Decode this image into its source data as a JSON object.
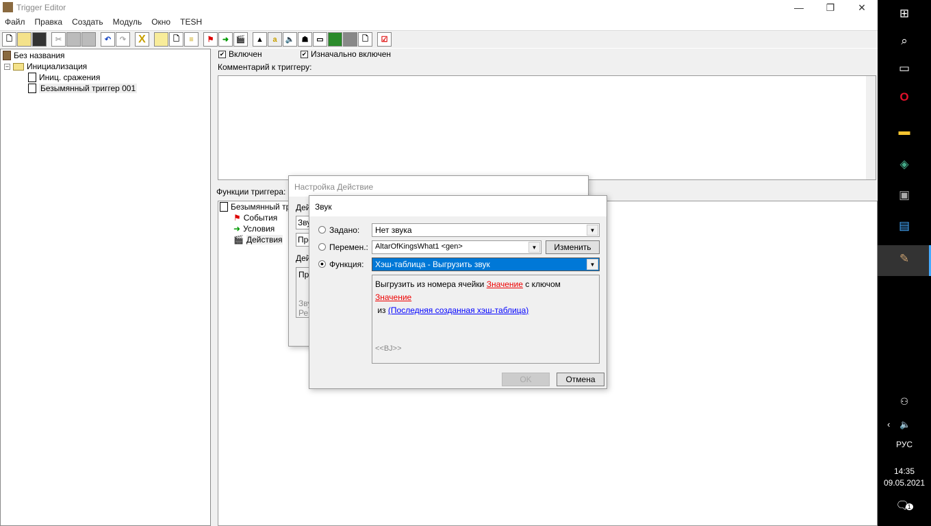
{
  "window": {
    "title": "Trigger Editor",
    "minimize": "—",
    "restore": "❐",
    "close": "✕"
  },
  "menu": [
    "Файл",
    "Правка",
    "Создать",
    "Модуль",
    "Окно",
    "TESH"
  ],
  "toolbar": [
    "new",
    "open",
    "save",
    "cut",
    "copy",
    "paste",
    "undo",
    "redo",
    "X",
    "folder",
    "trigger",
    "comment",
    "event",
    "condition",
    "action",
    "terrain",
    "a",
    "sound",
    "unit",
    "tileset",
    "jass",
    "object",
    "import",
    "test"
  ],
  "tree": {
    "root": "Без названия",
    "category": "Инициализация",
    "items": [
      "Иниц. сражения",
      "Безымянный триггер 001"
    ]
  },
  "trigger": {
    "enabled_label": "Включен",
    "initially_on_label": "Изначально включен",
    "comment_label": "Комментарий к триггеру:",
    "functions_label": "Функции триггера:",
    "func_root": "Безымянный тр",
    "events": "События",
    "conditions": "Условия",
    "actions": "Действия"
  },
  "back_dialog": {
    "title": "Настройка Действие",
    "frag1": "Дей",
    "frag2": "Зву",
    "frag3": "Про",
    "frag4": "Дей",
    "frag5": "Пр",
    "frag6": "Зву",
    "frag7": "Ре"
  },
  "dialog": {
    "title": "Звук",
    "preset_label": "Задано:",
    "preset_value": "Нет звука",
    "var_label": "Перемен.:",
    "var_value": "AltarOfKingsWhat1 <gen>",
    "edit_button": "Изменить",
    "func_label": "Функция:",
    "func_value": "Хэш-таблица - Выгрузить звук",
    "desc_1": "Выгрузить из номера ячейки",
    "param_1": "Значение",
    "desc_2": "с ключом",
    "param_2": "Значение",
    "desc_3": "из",
    "param_3": "(Последняя созданная хэш-таблица)",
    "tag": "<<BJ>>",
    "ok": "OK",
    "cancel": "Отмена",
    "selected": "function"
  },
  "taskbar": {
    "lang": "РУС",
    "time": "14:35",
    "date": "09.05.2021",
    "notifications": "1"
  }
}
